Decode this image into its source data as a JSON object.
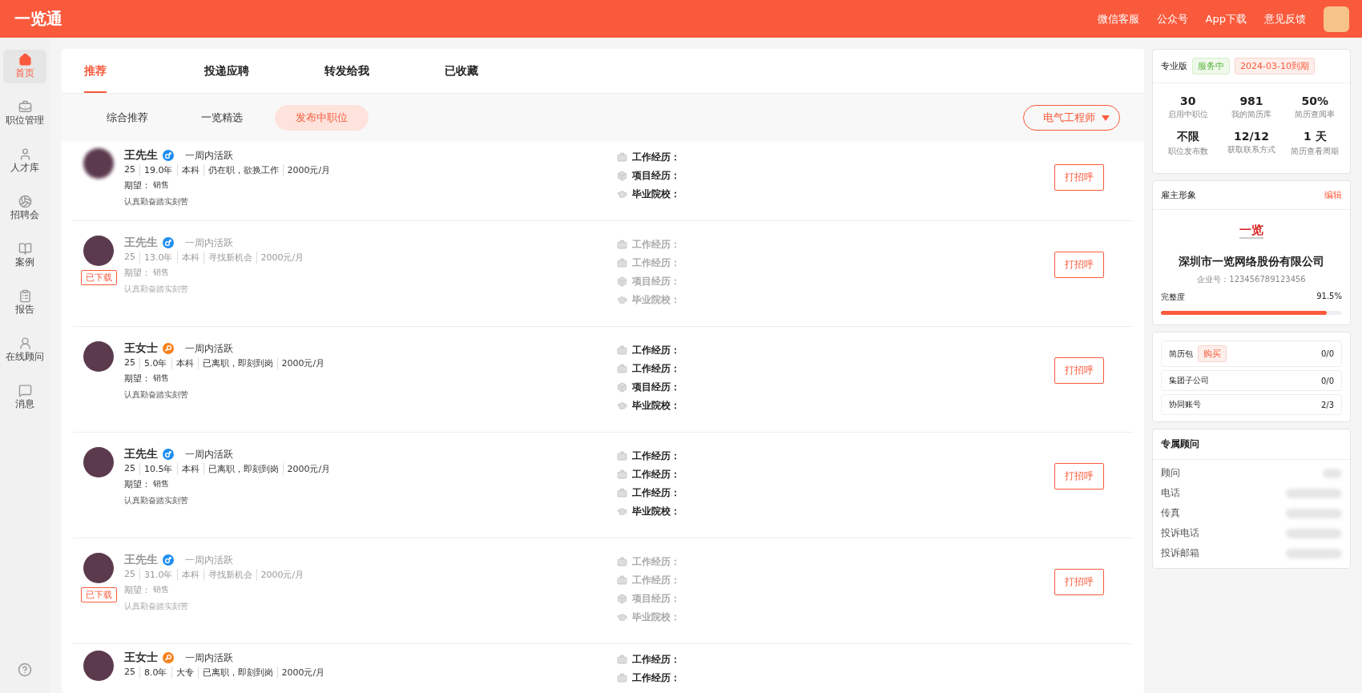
{
  "header": {
    "logo": "一览通",
    "links": [
      "微信客服",
      "公众号",
      "App下载",
      "意见反馈"
    ]
  },
  "sidebar": {
    "items": [
      {
        "label": "首页",
        "selected": true
      },
      {
        "label": "职位管理",
        "selected": false
      },
      {
        "label": "人才库",
        "selected": false
      },
      {
        "label": "招聘会",
        "selected": false
      },
      {
        "label": "案例",
        "selected": false
      },
      {
        "label": "报告",
        "selected": false
      },
      {
        "label": "在线顾问",
        "selected": false
      },
      {
        "label": "消息",
        "selected": false
      }
    ]
  },
  "tabs": [
    {
      "label": "推荐",
      "selected": true
    },
    {
      "label": "投递应聘",
      "selected": false
    },
    {
      "label": "转发给我",
      "selected": false
    },
    {
      "label": "已收藏",
      "selected": false
    }
  ],
  "subtabs": [
    {
      "label": "综合推荐",
      "selected": false
    },
    {
      "label": "一览精选",
      "selected": false
    },
    {
      "label": "发布中职位",
      "selected": true
    }
  ],
  "job_select": {
    "value": "电气工程师"
  },
  "candidates": [
    {
      "name": "王先生",
      "female": false,
      "activity": "一周内活跃",
      "downloaded": false,
      "blurred": true,
      "meta": [
        "25",
        "19.0年",
        "本科",
        "仍在职，欲换工作",
        "2000元/月"
      ],
      "expect_label": "期望：",
      "expect": "销售",
      "motto": "认真勤奋踏实刻苦",
      "experience": [
        {
          "kind": "work",
          "label": "工作经历："
        },
        {
          "kind": "project",
          "label": "项目经历："
        },
        {
          "kind": "school",
          "label": "毕业院校："
        }
      ],
      "button": "打招呼"
    },
    {
      "name": "王先生",
      "female": false,
      "activity": "一周内活跃",
      "downloaded": true,
      "badge": "已下载",
      "meta": [
        "25",
        "13.0年",
        "本科",
        "寻找新机会",
        "2000元/月"
      ],
      "expect_label": "期望：",
      "expect": "销售",
      "motto": "认真勤奋踏实刻苦",
      "experience": [
        {
          "kind": "work",
          "label": "工作经历："
        },
        {
          "kind": "work",
          "label": "工作经历："
        },
        {
          "kind": "project",
          "label": "项目经历："
        },
        {
          "kind": "school",
          "label": "毕业院校："
        }
      ],
      "button": "打招呼"
    },
    {
      "name": "王女士",
      "female": true,
      "activity": "一周内活跃",
      "downloaded": false,
      "meta": [
        "25",
        "5.0年",
        "本科",
        "已离职，即刻到岗",
        "2000元/月"
      ],
      "expect_label": "期望：",
      "expect": "销售",
      "motto": "认真勤奋踏实刻苦",
      "experience": [
        {
          "kind": "work",
          "label": "工作经历："
        },
        {
          "kind": "work",
          "label": "工作经历："
        },
        {
          "kind": "project",
          "label": "项目经历："
        },
        {
          "kind": "school",
          "label": "毕业院校："
        }
      ],
      "button": "打招呼"
    },
    {
      "name": "王先生",
      "female": false,
      "activity": "一周内活跃",
      "downloaded": false,
      "meta": [
        "25",
        "10.5年",
        "本科",
        "已离职，即刻到岗",
        "2000元/月"
      ],
      "expect_label": "期望：",
      "expect": "销售",
      "motto": "认真勤奋踏实刻苦",
      "experience": [
        {
          "kind": "work",
          "label": "工作经历："
        },
        {
          "kind": "work",
          "label": "工作经历："
        },
        {
          "kind": "work",
          "label": "工作经历："
        },
        {
          "kind": "school",
          "label": "毕业院校："
        }
      ],
      "button": "打招呼"
    },
    {
      "name": "王先生",
      "female": false,
      "activity": "一周内活跃",
      "downloaded": true,
      "badge": "已下载",
      "meta": [
        "25",
        "31.0年",
        "本科",
        "寻找新机会",
        "2000元/月"
      ],
      "expect_label": "期望：",
      "expect": "销售",
      "motto": "认真勤奋踏实刻苦",
      "experience": [
        {
          "kind": "work",
          "label": "工作经历："
        },
        {
          "kind": "work",
          "label": "工作经历："
        },
        {
          "kind": "project",
          "label": "项目经历："
        },
        {
          "kind": "school",
          "label": "毕业院校："
        }
      ],
      "button": "打招呼"
    },
    {
      "name": "王女士",
      "female": true,
      "activity": "一周内活跃",
      "downloaded": false,
      "meta": [
        "25",
        "8.0年",
        "大专",
        "已离职，即刻到岗",
        "2000元/月"
      ],
      "experience": [
        {
          "kind": "work",
          "label": "工作经历："
        },
        {
          "kind": "work",
          "label": "工作经历："
        }
      ]
    }
  ],
  "plan": {
    "name": "专业版",
    "status": "服务中",
    "expiry": "2024-03-10到期",
    "stats": [
      {
        "value": "30",
        "label": "启用中职位"
      },
      {
        "value": "981",
        "label": "我的简历库"
      },
      {
        "value": "50%",
        "label": "简历查阅率"
      },
      {
        "value": "不限",
        "label": "职位发布数"
      },
      {
        "value": "12/12",
        "label": "获取联系方式"
      },
      {
        "value": "1 天",
        "label": "简历查看周期"
      }
    ]
  },
  "employer": {
    "title": "雇主形象",
    "edit": "编辑",
    "logo": "一览",
    "company": "深圳市一览网络股份有限公司",
    "company_id": "企业号：123456789123456",
    "completeness_label": "完整度",
    "completeness": "91.5%",
    "level": 0.915
  },
  "resources": [
    {
      "label": "简历包",
      "action": "购买",
      "value": "0/0"
    },
    {
      "label": "集团子公司",
      "value": "0/0"
    },
    {
      "label": "协同账号",
      "value": "2/3"
    }
  ],
  "advisor": {
    "title": "专属顾问",
    "fields": [
      "顾问",
      "电话",
      "传真",
      "投诉电话",
      "投诉邮箱"
    ]
  }
}
